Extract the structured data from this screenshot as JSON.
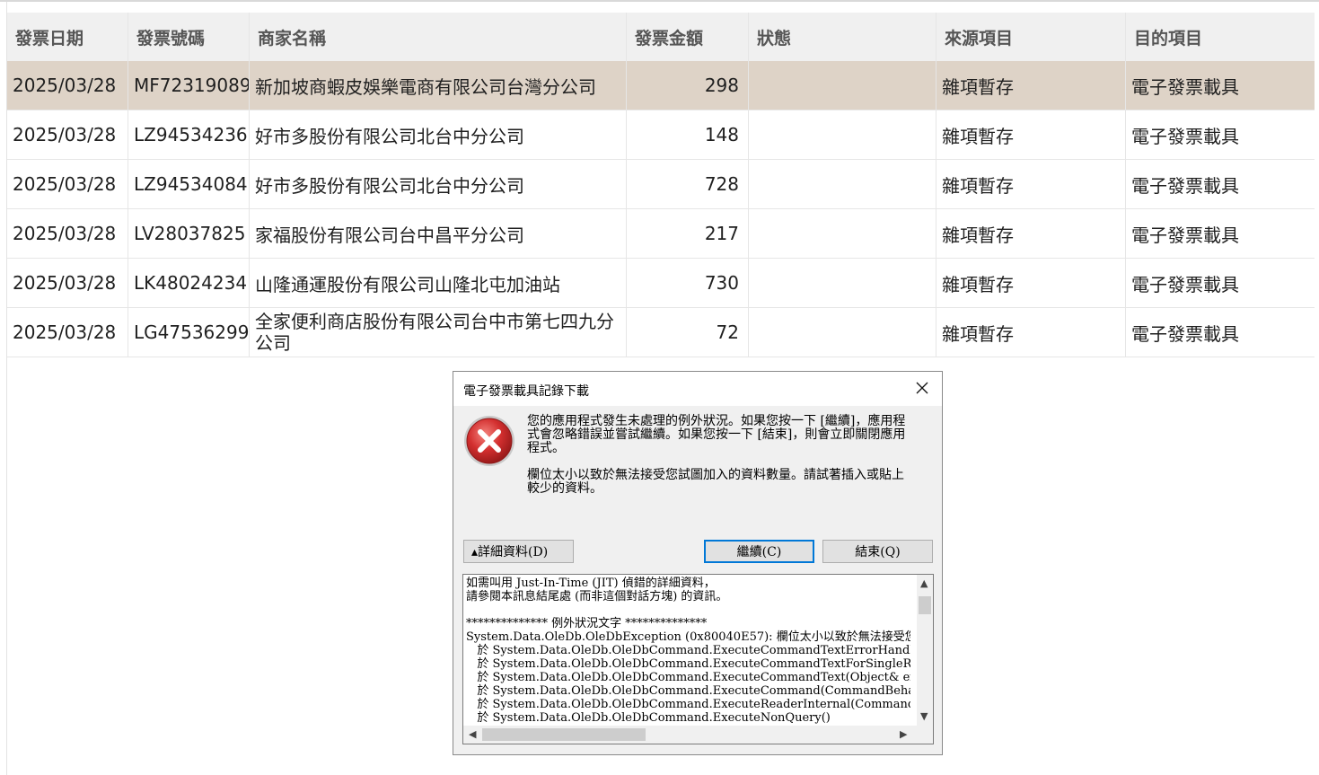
{
  "grid": {
    "headers": [
      "發票日期",
      "發票號碼",
      "商家名稱",
      "發票金額",
      "狀態",
      "來源項目",
      "目的項目"
    ],
    "rows": [
      {
        "date": "2025/03/28",
        "no": "MF72319089",
        "name": "新加坡商蝦皮娛樂電商有限公司台灣分公司",
        "amount": "298",
        "status": "",
        "src": "雜項暫存",
        "dst": "電子發票載具"
      },
      {
        "date": "2025/03/28",
        "no": "LZ94534236",
        "name": "好市多股份有限公司北台中分公司",
        "amount": "148",
        "status": "",
        "src": "雜項暫存",
        "dst": "電子發票載具"
      },
      {
        "date": "2025/03/28",
        "no": "LZ94534084",
        "name": "好市多股份有限公司北台中分公司",
        "amount": "728",
        "status": "",
        "src": "雜項暫存",
        "dst": "電子發票載具"
      },
      {
        "date": "2025/03/28",
        "no": "LV28037825",
        "name": "家福股份有限公司台中昌平分公司",
        "amount": "217",
        "status": "",
        "src": "雜項暫存",
        "dst": "電子發票載具"
      },
      {
        "date": "2025/03/28",
        "no": "LK48024234",
        "name": "山隆通運股份有限公司山隆北屯加油站",
        "amount": "730",
        "status": "",
        "src": "雜項暫存",
        "dst": "電子發票載具"
      },
      {
        "date": "2025/03/28",
        "no": "LG47536299",
        "name": "全家便利商店股份有限公司台中市第七四九分公司",
        "amount": "72",
        "status": "",
        "src": "雜項暫存",
        "dst": "電子發票載具"
      }
    ]
  },
  "dialog": {
    "title": "電子發票載具記錄下載",
    "message1": "您的應用程式發生未處理的例外狀況。如果您按一下 [繼續]，應用程式會忽略錯誤並嘗試繼續。如果您按一下 [結束]，則會立即關閉應用程式。",
    "message2": "欄位太小以致於無法接受您試圖加入的資料數量。請試著插入或貼上較少的資料。",
    "details_button": "▴詳細資料(D)",
    "continue_button": "繼續(C)",
    "quit_button": "結束(Q)",
    "details_text": "如需叫用 Just-In-Time (JIT) 偵錯的詳細資料，\n請參閱本訊息結尾處 (而非這個對話方塊) 的資訊。\n\n************** 例外狀況文字 **************\nSystem.Data.OleDb.OleDbException (0x80040E57): 欄位太小以致於無法接受您試\n   於 System.Data.OleDb.OleDbCommand.ExecuteCommandTextErrorHandling(OleD\n   於 System.Data.OleDb.OleDbCommand.ExecuteCommandTextForSingleResult(tag\n   於 System.Data.OleDb.OleDbCommand.ExecuteCommandText(Object& executeRe\n   於 System.Data.OleDb.OleDbCommand.ExecuteCommand(CommandBehavior be\n   於 System.Data.OleDb.OleDbCommand.ExecuteReaderInternal(CommandBehavio\n   於 System.Data.OleDb.OleDbCommand.ExecuteNonQuery()",
    "colors": {
      "accent": "#0078d7",
      "error": "#d32f2f",
      "selected_row": "#ded3c7"
    }
  }
}
